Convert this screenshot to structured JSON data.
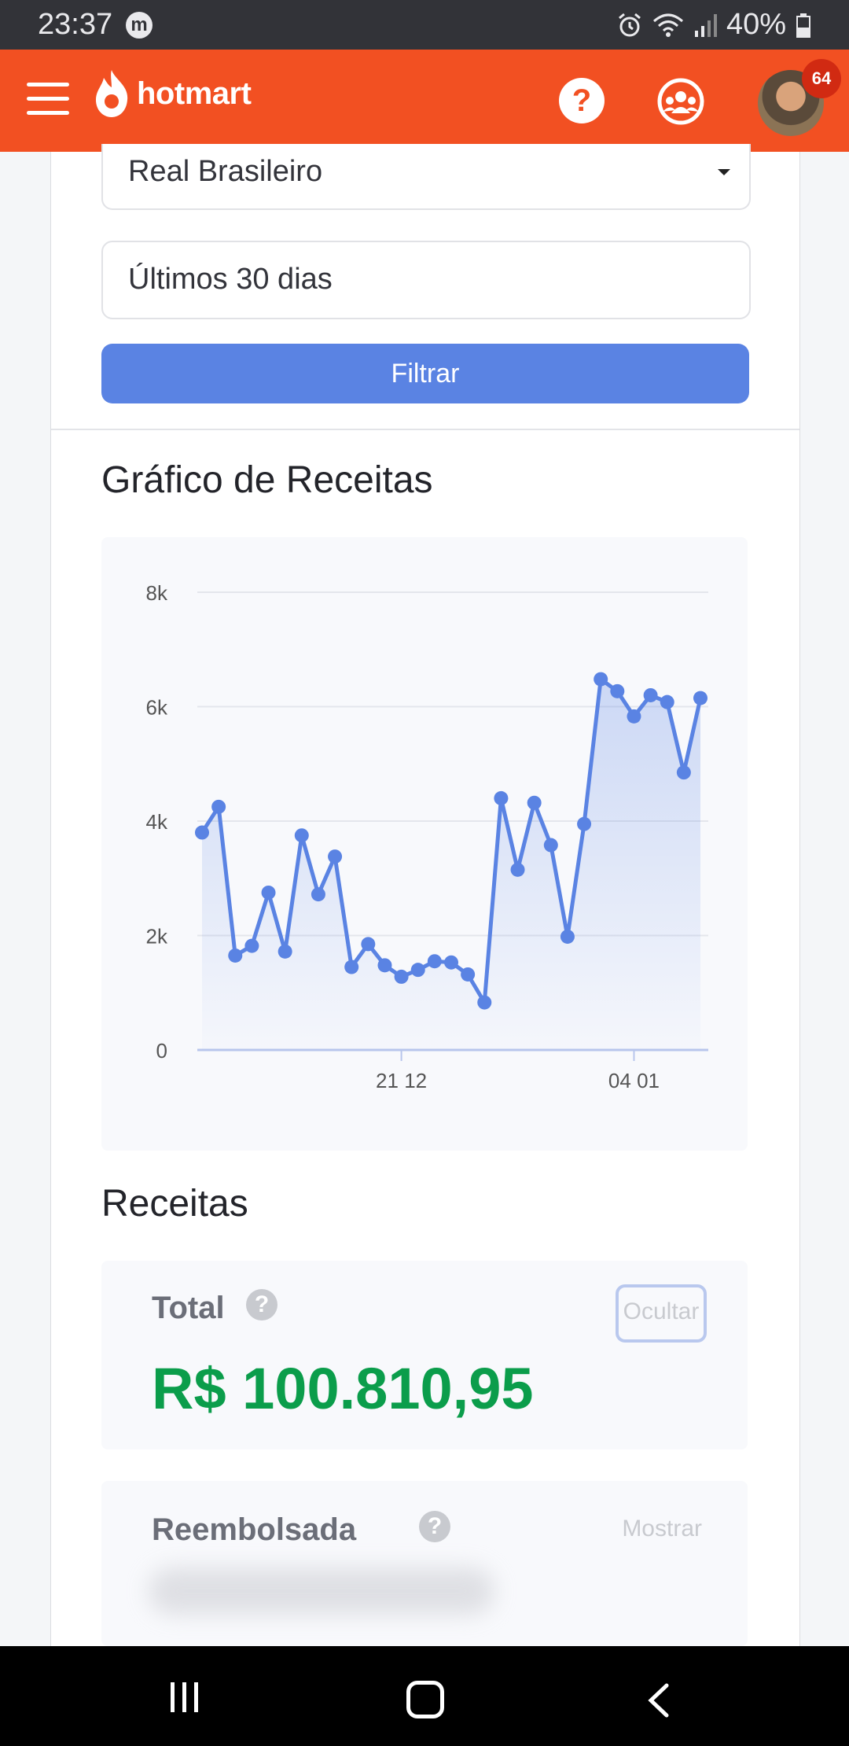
{
  "status_bar": {
    "time": "23:37",
    "app_icon": "m",
    "battery": "40%",
    "icons": [
      "alarm-icon",
      "wifi-icon",
      "signal-icon",
      "battery-icon"
    ]
  },
  "header": {
    "brand": "hotmart",
    "notification_count": "64",
    "icons": [
      "menu-icon",
      "flame-logo-icon",
      "help-icon",
      "community-icon",
      "avatar"
    ],
    "color": "#f25022"
  },
  "filters": {
    "currency": "Real Brasileiro",
    "period": "Últimos 30 dias",
    "filter_button": "Filtrar"
  },
  "chart_section": {
    "title": "Gráfico de Receitas"
  },
  "chart_data": {
    "type": "area",
    "y_ticks": [
      "0",
      "2k",
      "4k",
      "6k",
      "8k"
    ],
    "x_ticks": [
      "21 12",
      "04 01"
    ],
    "ylim": [
      0,
      8000
    ],
    "grid": true,
    "color": "#5a83e3",
    "values": [
      3800,
      4250,
      1650,
      1820,
      2750,
      1720,
      3750,
      2720,
      3380,
      1450,
      1850,
      1480,
      1280,
      1400,
      1550,
      1530,
      1320,
      830,
      4400,
      3150,
      4320,
      3580,
      1980,
      3950,
      6480,
      6270,
      5830,
      6200,
      6080,
      4850,
      6150
    ],
    "x_tick_index": [
      12,
      26
    ]
  },
  "revenue_section": {
    "title": "Receitas",
    "total_label": "Total",
    "total_value": "R$ 100.810,95",
    "hide_label": "Ocultar",
    "refunded_label": "Reembolsada",
    "show_label": "Mostrar",
    "help_glyph": "?"
  },
  "nav_bar": {
    "icons": [
      "recent-apps-icon",
      "home-icon",
      "back-icon"
    ]
  }
}
